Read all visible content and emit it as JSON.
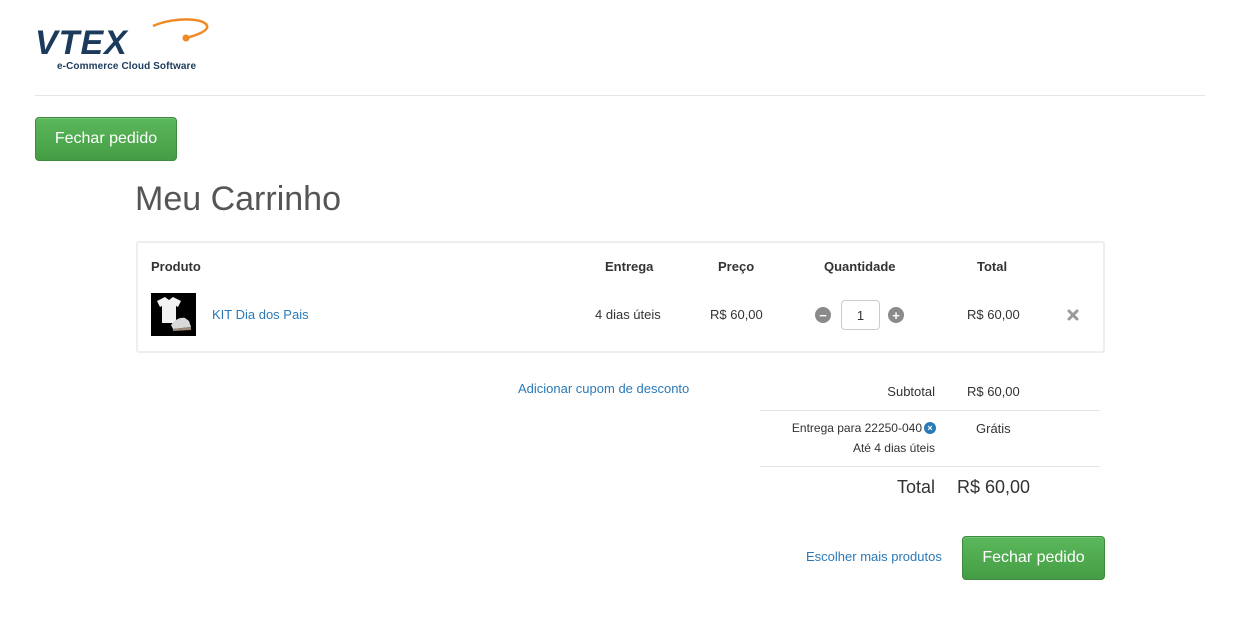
{
  "brand": {
    "logo_text": "VTEX",
    "tagline": "e-Commerce Cloud Software",
    "primary_color": "#1b3a5c",
    "accent_color": "#f08a24"
  },
  "actions": {
    "checkout_top_label": "Fechar pedido",
    "checkout_bottom_label": "Fechar pedido",
    "continue_shopping_label": "Escolher mais produtos",
    "add_coupon_label": "Adicionar cupom de desconto",
    "button_color": "#5cb85c"
  },
  "page": {
    "title": "Meu Carrinho"
  },
  "cart": {
    "headers": {
      "product": "Produto",
      "delivery": "Entrega",
      "price": "Preço",
      "quantity": "Quantidade",
      "total": "Total"
    },
    "items": [
      {
        "name": "KIT Dia dos Pais",
        "delivery": "4 dias úteis",
        "price": "R$ 60,00",
        "quantity": "1",
        "total": "R$ 60,00",
        "thumb_icon": "tshirt-and-sneaker-image"
      }
    ]
  },
  "summary": {
    "subtotal_label": "Subtotal",
    "subtotal_value": "R$ 60,00",
    "shipping_label": "Entrega para 22250-040",
    "shipping_eta": "Até 4 dias úteis",
    "shipping_value": "Grátis",
    "total_label": "Total",
    "total_value": "R$ 60,00"
  }
}
